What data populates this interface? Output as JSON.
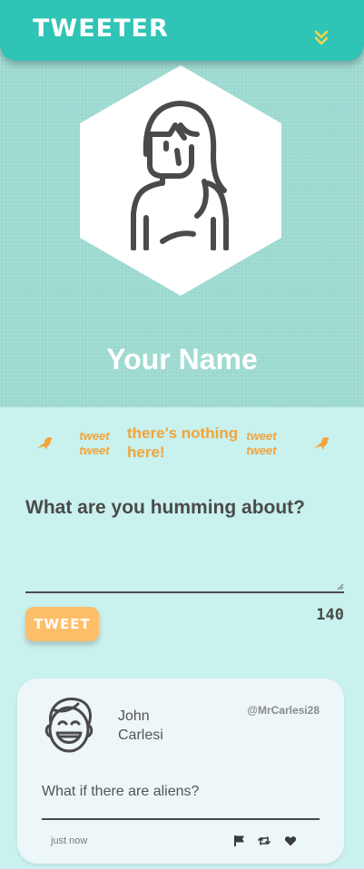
{
  "nav": {
    "brand": "TWEETER",
    "toggle_icon": "double-chevron-down-icon"
  },
  "profile": {
    "name": "Your Name",
    "avatar_icon": "woman-avatar-icon"
  },
  "empty_state": {
    "left_tweet": "tweet tweet",
    "right_tweet": "tweet tweet",
    "message": "there's nothing here!",
    "bird_icon": "bird-icon"
  },
  "compose": {
    "placeholder": "What are you humming about?",
    "value": ""
  },
  "tweet_button": {
    "label": "TWEET"
  },
  "counter": "140",
  "tweets": [
    {
      "name": "John Carlesi",
      "handle": "@MrCarlesi28",
      "avatar_icon": "laughing-man-avatar-icon",
      "content": "What if there are aliens?",
      "time": "just now",
      "actions": [
        "flag-icon",
        "retweet-icon",
        "heart-icon"
      ]
    }
  ],
  "colors": {
    "nav": "#2fc4b5",
    "hero": "#9bd8cf",
    "background": "#c9f1ed",
    "accent": "#f2a43a",
    "button": "#ffbe6a",
    "text": "#4a4a4a",
    "card": "#edf6f9"
  }
}
